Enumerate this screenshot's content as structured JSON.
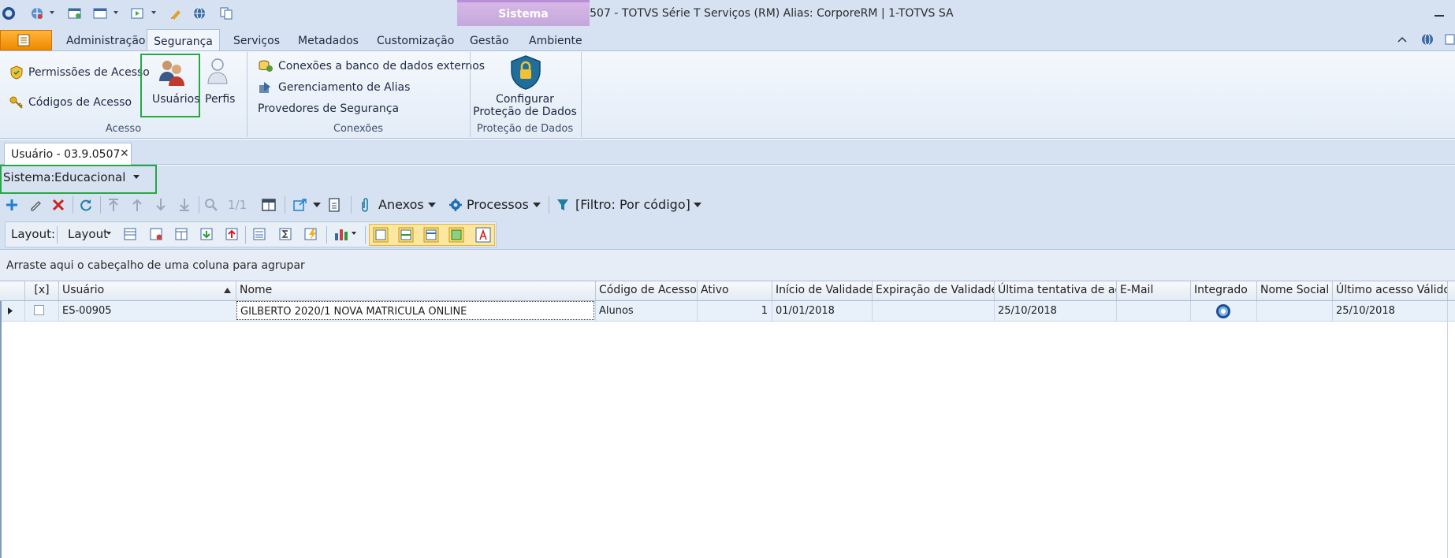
{
  "window": {
    "title": "Usuário - 03.9.0507 - TOTVS Série T Serviços (RM) Alias: CorporeRM | 1-TOTVS SA",
    "context_group": "Sistema"
  },
  "ribbon": {
    "tabs": [
      {
        "label": "Administração"
      },
      {
        "label": "Segurança"
      },
      {
        "label": "Serviços"
      },
      {
        "label": "Metadados"
      },
      {
        "label": "Customização"
      },
      {
        "label": "Gestão"
      },
      {
        "label": "Ambiente"
      }
    ],
    "groups": {
      "acesso": {
        "label": "Acesso",
        "permissoes": "Permissões de Acesso",
        "codigos": "Códigos de Acesso",
        "usuarios": "Usuários",
        "perfis": "Perfis"
      },
      "conexoes": {
        "label": "Conexões",
        "bancos": "Conexões a banco de dados externos",
        "alias": "Gerenciamento de Alias",
        "provedores": "Provedores de Segurança"
      },
      "protecao": {
        "label": "Proteção de Dados",
        "configurar_line1": "Configurar",
        "configurar_line2": "Proteção de Dados"
      }
    }
  },
  "document_tab": {
    "label": "Usuário - 03.9.0507"
  },
  "sistema": {
    "label": "Sistema:",
    "value": "Educacional"
  },
  "toolbar": {
    "page": "1/1",
    "anexos": "Anexos",
    "processos": "Processos",
    "filtro": "[Filtro: Por código]"
  },
  "layout_bar": {
    "label": "Layout:",
    "button": "Layout"
  },
  "group_panel": "Arraste aqui o cabeçalho de uma coluna para agrupar",
  "grid": {
    "columns": [
      "[x]",
      "Usuário",
      "Nome",
      "Código de Acesso",
      "Ativo",
      "Início de Validade",
      "Expiração de Validade",
      "Última tentativa de ac...",
      "E-Mail",
      "Integrado",
      "Nome Social",
      "Último acesso Válido"
    ],
    "rows": [
      {
        "usuario": "ES-00905",
        "nome": "GILBERTO 2020/1 NOVA MATRICULA ONLINE",
        "codigo": "Alunos",
        "ativo": "1",
        "inicio": "01/01/2018",
        "expiracao": "",
        "ultima_tentativa": "25/10/2018",
        "email": "",
        "nome_social": "",
        "ultimo_acesso": "25/10/2018"
      }
    ]
  },
  "colors": {
    "frame": "#d6e2f2",
    "highlight": "#27a844",
    "accent_orange": "#f08a00",
    "context_purple": "#c5a8dc"
  }
}
